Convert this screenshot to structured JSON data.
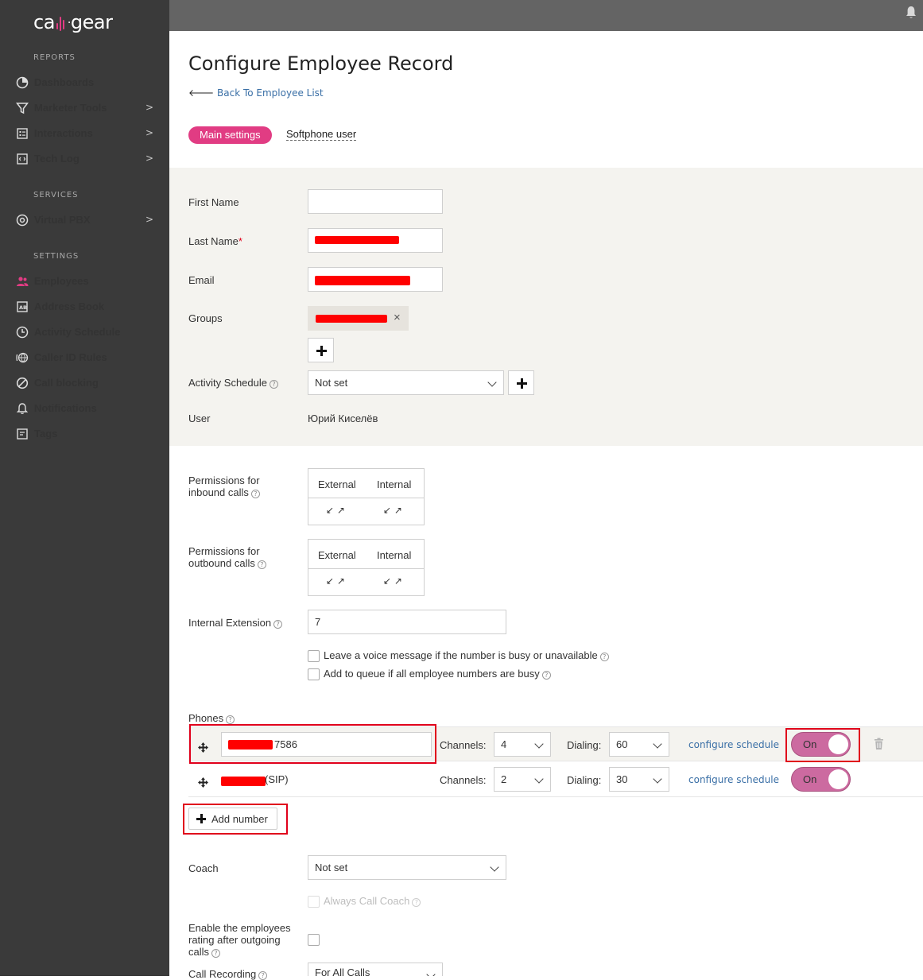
{
  "brand": {
    "logo_text_left": "ca",
    "logo_text_right": "gear",
    "accent": "#e13c83"
  },
  "sidebar": {
    "sections": [
      {
        "title": "REPORTS"
      },
      {
        "title": "SERVICES"
      },
      {
        "title": "SETTINGS"
      }
    ],
    "items": [
      {
        "label": "Dashboards",
        "icon": "pie-chart-icon",
        "chevron": ""
      },
      {
        "label": "Marketer Tools",
        "icon": "filter-icon",
        "chevron": ">"
      },
      {
        "label": "Interactions",
        "icon": "grid-icon",
        "chevron": ">"
      },
      {
        "label": "Tech Log",
        "icon": "code-file-icon",
        "chevron": ">"
      },
      {
        "label": "Virtual PBX",
        "icon": "pbx-icon",
        "chevron": ">"
      },
      {
        "label": "Employees",
        "icon": "people-icon",
        "chevron": ""
      },
      {
        "label": "Address Book",
        "icon": "address-book-icon",
        "chevron": ""
      },
      {
        "label": "Activity Schedule",
        "icon": "clock-icon",
        "chevron": ""
      },
      {
        "label": "Caller ID Rules",
        "icon": "globe-phone-icon",
        "chevron": ""
      },
      {
        "label": "Call blocking",
        "icon": "block-icon",
        "chevron": ""
      },
      {
        "label": "Notifications",
        "icon": "bell-icon",
        "chevron": ""
      },
      {
        "label": "Tags",
        "icon": "tag-icon",
        "chevron": ""
      }
    ]
  },
  "header": {
    "title": "Configure Employee Record",
    "back_link": "Back To Employee List"
  },
  "tabs": {
    "main": "Main settings",
    "softphone": "Softphone user"
  },
  "form": {
    "first_name_label": "First Name",
    "first_name_value": "",
    "last_name_label": "Last Name",
    "required_mark": "*",
    "email_label": "Email",
    "groups_label": "Groups",
    "group_remove": "×",
    "activity_schedule_label": "Activity Schedule",
    "activity_schedule_value": "Not set",
    "user_label": "User",
    "user_value": "Юрий Киселёв",
    "help_glyph": "?"
  },
  "permissions": {
    "inbound_label_1": "Permissions for",
    "inbound_label_2": "inbound calls",
    "outbound_label_1": "Permissions for",
    "outbound_label_2": "outbound calls",
    "col_external": "External",
    "col_internal": "Internal",
    "arrows": "↙ ↗"
  },
  "extension": {
    "label": "Internal Extension",
    "value": "7"
  },
  "options": {
    "voice_message": "Leave a voice message if the number is busy or unavailable",
    "add_to_queue": "Add to queue if all employee numbers are busy"
  },
  "phones": {
    "label": "Phones",
    "channels_label": "Channels:",
    "dialing_label": "Dialing:",
    "schedule_link": "configure schedule",
    "rows": [
      {
        "number_suffix": "7586",
        "channels": "4",
        "dialing": "60",
        "toggle": "On"
      },
      {
        "number_suffix": "(SIP)",
        "channels": "2",
        "dialing": "30",
        "toggle": "On"
      }
    ],
    "add_number": "Add number"
  },
  "coach": {
    "label": "Coach",
    "value": "Not set",
    "always_call": "Always Call Coach"
  },
  "rating": {
    "label_1": "Enable the employees",
    "label_2": "rating after outgoing",
    "label_3": "calls"
  },
  "recording": {
    "label": "Call Recording",
    "value": "For All Calls"
  }
}
